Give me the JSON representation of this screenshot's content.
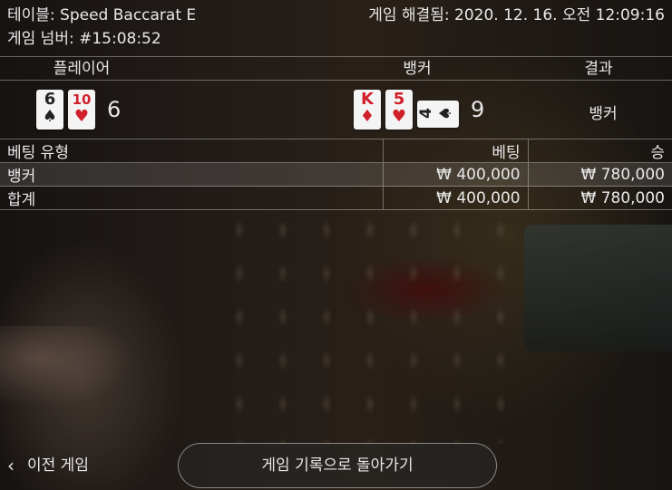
{
  "header": {
    "table_label": "테이블: Speed Baccarat E",
    "round_label": "게임 넘버: #15:08:52",
    "settled_label": "게임 해결됨: 2020. 12. 16. 오전 12:09:16"
  },
  "hands": {
    "player_header": "플레이어",
    "banker_header": "뱅커",
    "result_header": "결과",
    "player": {
      "cards": [
        {
          "rank": "6",
          "suit": "♠",
          "color": "#222222"
        },
        {
          "rank": "10",
          "suit": "♥",
          "color": "#d0202a"
        }
      ],
      "total": "6"
    },
    "banker": {
      "cards": [
        {
          "rank": "K",
          "suit": "♦",
          "color": "#d0202a"
        },
        {
          "rank": "5",
          "suit": "♥",
          "color": "#d0202a"
        },
        {
          "rank": "4",
          "suit": "♠",
          "color": "#222222"
        }
      ],
      "total": "9"
    },
    "result": "뱅커"
  },
  "bets": {
    "headers": {
      "type": "베팅 유형",
      "bet": "베팅",
      "win": "승"
    },
    "rows": [
      {
        "type": "뱅커",
        "bet": "₩ 400,000",
        "win": "₩ 780,000"
      },
      {
        "type": "합계",
        "bet": "₩ 400,000",
        "win": "₩ 780,000"
      }
    ]
  },
  "footer": {
    "back_label": "이전 게임",
    "history_button_label": "게임 기록으로 돌아가기",
    "back_icon": "chevron-left-icon"
  }
}
